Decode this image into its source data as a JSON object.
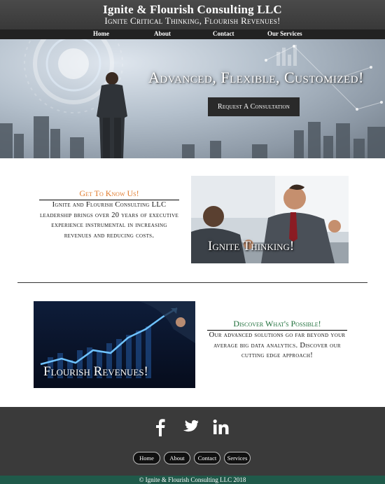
{
  "header": {
    "title": "Ignite & Flourish Consulting LLC",
    "tagline": "Ignite Critical Thinking, Flourish Revenues!"
  },
  "nav": {
    "items": [
      {
        "label": "Home"
      },
      {
        "label": "About"
      },
      {
        "label": "Contact"
      },
      {
        "label": "Our Services"
      }
    ]
  },
  "hero": {
    "heading": "Advanced, Flexible, Customized!",
    "cta_label": "Request A Consultation"
  },
  "about_block": {
    "title": "Get To Know Us!",
    "text": "Ignite and Flourish Consulting LLC leadership brings over 20 years of executive experience instrumental in increasing revenues and reducing costs.",
    "image_caption": "Ignite Thinking!"
  },
  "discover_block": {
    "title": "Discover What's Possible!",
    "text": "Our advanced solutions go far beyond your average big data analytics. Discover our cutting edge approach!",
    "image_caption": "Flourish Revenues!"
  },
  "footer": {
    "social": [
      {
        "icon": "facebook-icon",
        "glyph": "f"
      },
      {
        "icon": "twitter-icon",
        "glyph": ""
      },
      {
        "icon": "linkedin-icon",
        "glyph": "in"
      }
    ],
    "buttons": [
      {
        "label": "Home"
      },
      {
        "label": "About"
      },
      {
        "label": "Contact"
      },
      {
        "label": "Services"
      }
    ],
    "copyright": "© Ignite & Flourish Consulting LLC 2018"
  },
  "colors": {
    "header_bg": "#333333",
    "about_title": "#e07a2c",
    "discover_title": "#1e6e3a",
    "footer_bg": "#3a3a3a",
    "copyright_bg": "#1f5a4a"
  }
}
